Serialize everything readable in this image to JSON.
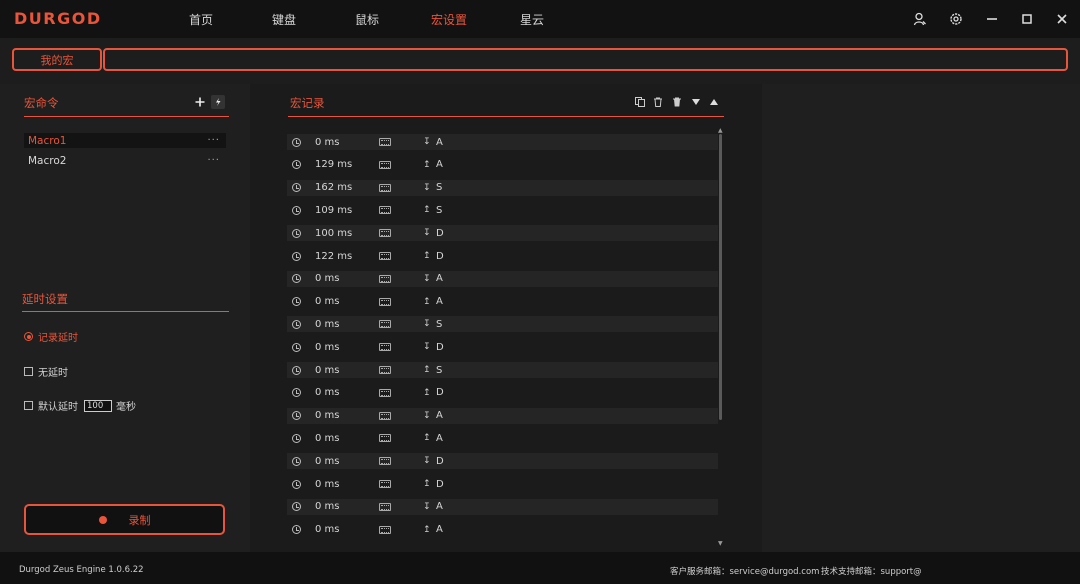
{
  "app": {
    "logo": "DURGOD"
  },
  "nav": [
    {
      "label": "首页",
      "active": false
    },
    {
      "label": "键盘",
      "active": false
    },
    {
      "label": "鼠标",
      "active": false
    },
    {
      "label": "宏设置",
      "active": true
    },
    {
      "label": "星云",
      "active": false
    }
  ],
  "window_icons": [
    "user-icon",
    "settings-icon",
    "minimize-icon",
    "maximize-icon",
    "close-icon"
  ],
  "tabs": {
    "mine": "我的宏"
  },
  "macro_panel": {
    "title": "宏命令",
    "items": [
      {
        "label": "Macro1",
        "selected": true,
        "more": "···"
      },
      {
        "label": "Macro2",
        "selected": false,
        "more": "···"
      }
    ]
  },
  "delay_panel": {
    "title": "延时设置",
    "record_delay": "记录延时",
    "no_delay": "无延时",
    "default_delay": "默认延时",
    "default_value": "100",
    "unit": "毫秒"
  },
  "record_button": {
    "label": "录制"
  },
  "record_panel": {
    "title": "宏记录",
    "rows": [
      {
        "time": "0 ms",
        "dir": "↧",
        "key": "A"
      },
      {
        "time": "129 ms",
        "dir": "↥",
        "key": "A"
      },
      {
        "time": "162 ms",
        "dir": "↧",
        "key": "S"
      },
      {
        "time": "109 ms",
        "dir": "↥",
        "key": "S"
      },
      {
        "time": "100 ms",
        "dir": "↧",
        "key": "D"
      },
      {
        "time": "122 ms",
        "dir": "↥",
        "key": "D"
      },
      {
        "time": "0 ms",
        "dir": "↧",
        "key": "A"
      },
      {
        "time": "0 ms",
        "dir": "↥",
        "key": "A"
      },
      {
        "time": "0 ms",
        "dir": "↧",
        "key": "S"
      },
      {
        "time": "0 ms",
        "dir": "↧",
        "key": "D"
      },
      {
        "time": "0 ms",
        "dir": "↥",
        "key": "S"
      },
      {
        "time": "0 ms",
        "dir": "↥",
        "key": "D"
      },
      {
        "time": "0 ms",
        "dir": "↧",
        "key": "A"
      },
      {
        "time": "0 ms",
        "dir": "↥",
        "key": "A"
      },
      {
        "time": "0 ms",
        "dir": "↧",
        "key": "D"
      },
      {
        "time": "0 ms",
        "dir": "↥",
        "key": "D"
      },
      {
        "time": "0 ms",
        "dir": "↧",
        "key": "A"
      },
      {
        "time": "0 ms",
        "dir": "↥",
        "key": "A"
      }
    ]
  },
  "footer": {
    "engine": "Durgod Zeus Engine 1.0.6.22",
    "service": "客户服务邮箱：service@durgod.com",
    "support": "技术支持邮箱：support@"
  },
  "colors": {
    "accent": "#e9553a",
    "background": "#1a1a1a"
  }
}
